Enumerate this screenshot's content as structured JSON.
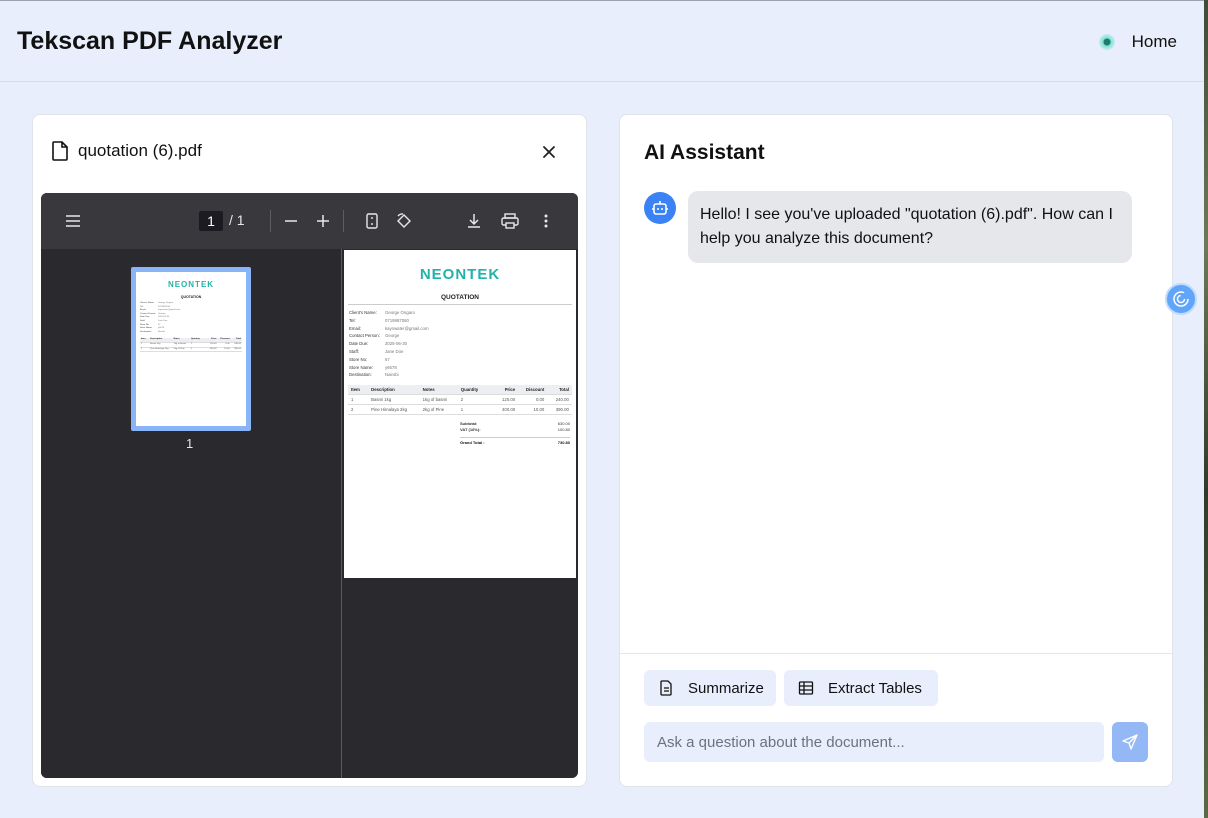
{
  "header": {
    "app_title": "Tekscan PDF Analyzer",
    "home_label": "Home"
  },
  "pdf_panel": {
    "file_name": "quotation (6).pdf",
    "close_icon": "close-icon",
    "toolbar": {
      "current_page": "1",
      "page_total": "/ 1",
      "icons": [
        "sidebar-toggle-icon",
        "zoom-out-icon",
        "zoom-in-icon",
        "page-fit-icon",
        "rotate-icon",
        "download-icon",
        "print-icon",
        "more-icon"
      ]
    },
    "thumbnail_label": "1",
    "document": {
      "logo": "NEONTEK",
      "title": "QUOTATION",
      "fields": [
        {
          "label": "Client's Name:",
          "value": "George Ongaro"
        },
        {
          "label": "Tel:",
          "value": "0719987060"
        },
        {
          "label": "Email:",
          "value": "kaynwater@gmail.com"
        },
        {
          "label": "Contact Person:",
          "value": "George"
        },
        {
          "label": "Date Due:",
          "value": "2025-06-30"
        },
        {
          "label": "Staff:",
          "value": "Jane Doe"
        },
        {
          "label": "Store No:",
          "value": "67"
        },
        {
          "label": "Store Name:",
          "value": "y6678"
        },
        {
          "label": "Destination:",
          "value": "Nairobi"
        }
      ],
      "table_headers": [
        "Item",
        "Description",
        "Notes",
        "Quantity",
        "Price",
        "Discount",
        "Total"
      ],
      "table_rows": [
        [
          "1",
          "Basmi 1kg",
          "1kg of basmi",
          "2",
          "120.00",
          "0.00",
          "240.00"
        ],
        [
          "2",
          "Pine Himalaya 2kg",
          "2kg of Pine",
          "1",
          "400.00",
          "10.00",
          "390.00"
        ]
      ],
      "totals": [
        {
          "label": "Subtotal:",
          "value": "630.00"
        },
        {
          "label": "VAT (16%):",
          "value": "100.80"
        },
        {
          "label": "Grand Total :",
          "value": "730.80"
        }
      ]
    }
  },
  "ai_panel": {
    "title": "AI Assistant",
    "messages": [
      {
        "role": "assistant",
        "text": "Hello! I see you've uploaded \"quotation (6).pdf\". How can I help you analyze this document?"
      }
    ],
    "actions": {
      "summarize_label": "Summarize",
      "extract_label": "Extract Tables"
    },
    "input": {
      "placeholder": "Ask a question about the document...",
      "value": ""
    }
  },
  "colors": {
    "background": "#e8eefb",
    "accent": "#3b82f6",
    "send_button": "#93b8f5",
    "logo_teal": "#22b3a8"
  }
}
